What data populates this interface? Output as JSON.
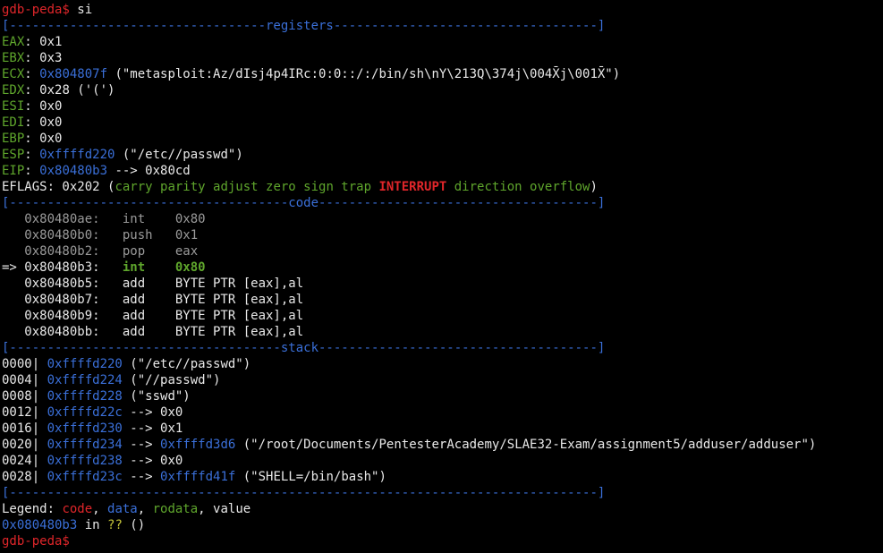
{
  "terminal": {
    "lines": [
      [
        {
          "t": "gdb-peda$",
          "c": "prompt"
        },
        {
          "t": " si",
          "c": "white"
        }
      ],
      [
        {
          "t": "[----------------------------------registers-----------------------------------]",
          "c": "blue"
        }
      ],
      [
        {
          "t": "EAX",
          "c": "reg"
        },
        {
          "t": ": 0x1",
          "c": "white"
        }
      ],
      [
        {
          "t": "EBX",
          "c": "reg"
        },
        {
          "t": ": 0x3",
          "c": "white"
        }
      ],
      [
        {
          "t": "ECX",
          "c": "reg"
        },
        {
          "t": ": ",
          "c": "white"
        },
        {
          "t": "0x804807f",
          "c": "blue"
        },
        {
          "t": " (\"metasploit:Az/dIsj4p4IRc:0:0::/:/bin/sh\\nY\\213Q\\374j\\004X̄j\\001X̄\")",
          "c": "white"
        }
      ],
      [
        {
          "t": "EDX",
          "c": "reg"
        },
        {
          "t": ": 0x28 ('(')",
          "c": "white"
        }
      ],
      [
        {
          "t": "ESI",
          "c": "reg"
        },
        {
          "t": ": 0x0",
          "c": "white"
        }
      ],
      [
        {
          "t": "EDI",
          "c": "reg"
        },
        {
          "t": ": 0x0",
          "c": "white"
        }
      ],
      [
        {
          "t": "EBP",
          "c": "reg"
        },
        {
          "t": ": 0x0",
          "c": "white"
        }
      ],
      [
        {
          "t": "ESP",
          "c": "reg"
        },
        {
          "t": ": ",
          "c": "white"
        },
        {
          "t": "0xffffd220",
          "c": "blue"
        },
        {
          "t": " (\"/etc//passwd\")",
          "c": "white"
        }
      ],
      [
        {
          "t": "EIP",
          "c": "reg"
        },
        {
          "t": ": ",
          "c": "white"
        },
        {
          "t": "0x80480b3",
          "c": "blue"
        },
        {
          "t": " --> 0x80cd",
          "c": "white"
        }
      ],
      [
        {
          "t": "EFLAGS",
          "c": "white"
        },
        {
          "t": ": 0x202 (",
          "c": "white"
        },
        {
          "t": "carry parity adjust zero sign trap ",
          "c": "green"
        },
        {
          "t": "INTERRUPT",
          "c": "redbold"
        },
        {
          "t": " direction overflow",
          "c": "green"
        },
        {
          "t": ")",
          "c": "white"
        }
      ],
      [
        {
          "t": "[-------------------------------------code-------------------------------------]",
          "c": "blue"
        }
      ],
      [
        {
          "t": "   0x80480ae:\tint    0x80",
          "c": "gray"
        }
      ],
      [
        {
          "t": "   0x80480b0:\tpush   0x1",
          "c": "gray"
        }
      ],
      [
        {
          "t": "   0x80480b2:\tpop    eax",
          "c": "gray"
        }
      ],
      [
        {
          "t": "=> 0x80480b3:\t",
          "c": "white"
        },
        {
          "t": "int    0x80",
          "c": "greenbold"
        }
      ],
      [
        {
          "t": "   0x80480b5:\tadd    BYTE PTR [eax],al",
          "c": "white"
        }
      ],
      [
        {
          "t": "   0x80480b7:\tadd    BYTE PTR [eax],al",
          "c": "white"
        }
      ],
      [
        {
          "t": "   0x80480b9:\tadd    BYTE PTR [eax],al",
          "c": "white"
        }
      ],
      [
        {
          "t": "   0x80480bb:\tadd    BYTE PTR [eax],al",
          "c": "white"
        }
      ],
      [
        {
          "t": "[------------------------------------stack-------------------------------------]",
          "c": "blue"
        }
      ],
      [
        {
          "t": "0000| ",
          "c": "white"
        },
        {
          "t": "0xffffd220",
          "c": "blue"
        },
        {
          "t": " (\"/etc//passwd\")",
          "c": "white"
        }
      ],
      [
        {
          "t": "0004| ",
          "c": "white"
        },
        {
          "t": "0xffffd224",
          "c": "blue"
        },
        {
          "t": " (\"//passwd\")",
          "c": "white"
        }
      ],
      [
        {
          "t": "0008| ",
          "c": "white"
        },
        {
          "t": "0xffffd228",
          "c": "blue"
        },
        {
          "t": " (\"sswd\")",
          "c": "white"
        }
      ],
      [
        {
          "t": "0012| ",
          "c": "white"
        },
        {
          "t": "0xffffd22c",
          "c": "blue"
        },
        {
          "t": " --> 0x0",
          "c": "white"
        }
      ],
      [
        {
          "t": "0016| ",
          "c": "white"
        },
        {
          "t": "0xffffd230",
          "c": "blue"
        },
        {
          "t": " --> 0x1",
          "c": "white"
        }
      ],
      [
        {
          "t": "0020| ",
          "c": "white"
        },
        {
          "t": "0xffffd234",
          "c": "blue"
        },
        {
          "t": " --> ",
          "c": "white"
        },
        {
          "t": "0xffffd3d6",
          "c": "blue"
        },
        {
          "t": " (\"/root/Documents/PentesterAcademy/SLAE32-Exam/assignment5/adduser/adduser\")",
          "c": "white"
        }
      ],
      [
        {
          "t": "0024| ",
          "c": "white"
        },
        {
          "t": "0xffffd238",
          "c": "blue"
        },
        {
          "t": " --> 0x0",
          "c": "white"
        }
      ],
      [
        {
          "t": "0028| ",
          "c": "white"
        },
        {
          "t": "0xffffd23c",
          "c": "blue"
        },
        {
          "t": " --> ",
          "c": "white"
        },
        {
          "t": "0xffffd41f",
          "c": "blue"
        },
        {
          "t": " (\"SHELL=/bin/bash\")",
          "c": "white"
        }
      ],
      [
        {
          "t": "[------------------------------------------------------------------------------]",
          "c": "blue"
        }
      ],
      [
        {
          "t": "Legend: ",
          "c": "white"
        },
        {
          "t": "code",
          "c": "red"
        },
        {
          "t": ", ",
          "c": "white"
        },
        {
          "t": "data",
          "c": "blue"
        },
        {
          "t": ", ",
          "c": "white"
        },
        {
          "t": "rodata",
          "c": "green"
        },
        {
          "t": ", value",
          "c": "white"
        }
      ],
      [
        {
          "t": "0x080480b3",
          "c": "blue"
        },
        {
          "t": " in ",
          "c": "white"
        },
        {
          "t": "??",
          "c": "yellow"
        },
        {
          "t": " ()",
          "c": "white"
        }
      ],
      [
        {
          "t": "gdb-peda$",
          "c": "prompt"
        },
        {
          "t": " ",
          "c": "white"
        }
      ]
    ]
  }
}
